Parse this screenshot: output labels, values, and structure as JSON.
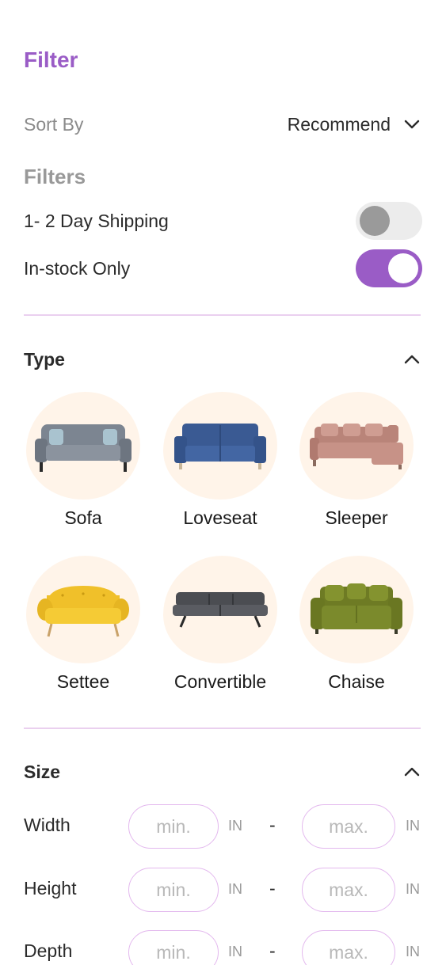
{
  "header": {
    "title": "Filter"
  },
  "sort": {
    "label": "Sort By",
    "value": "Recommend"
  },
  "filters": {
    "title": "Filters",
    "toggles": [
      {
        "label": "1- 2 Day Shipping",
        "on": false
      },
      {
        "label": "In-stock Only",
        "on": true
      }
    ]
  },
  "type": {
    "title": "Type",
    "items": [
      {
        "label": "Sofa",
        "icon": "sofa-icon",
        "color": "#7c8591"
      },
      {
        "label": "Loveseat",
        "icon": "loveseat-icon",
        "color": "#3a5a93"
      },
      {
        "label": "Sleeper",
        "icon": "sleeper-icon",
        "color": "#c79287"
      },
      {
        "label": "Settee",
        "icon": "settee-icon",
        "color": "#f0c02a"
      },
      {
        "label": "Convertible",
        "icon": "convertible-icon",
        "color": "#4b4d52"
      },
      {
        "label": "Chaise",
        "icon": "chaise-icon",
        "color": "#7b8a2c"
      }
    ]
  },
  "size": {
    "title": "Size",
    "unit": "IN",
    "separator": "-",
    "min_placeholder": "min.",
    "max_placeholder": "max.",
    "rows": [
      {
        "label": "Width"
      },
      {
        "label": "Height"
      },
      {
        "label": "Depth"
      }
    ]
  },
  "colors": {
    "accent": "#9a5cc6",
    "divider": "#ead0ef",
    "blob": "#fff4e9",
    "input_border": "#e3b8ee"
  }
}
